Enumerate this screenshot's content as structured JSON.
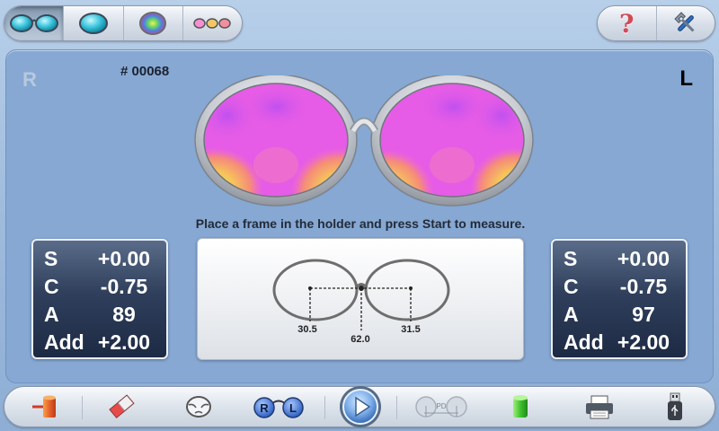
{
  "top_toolbar": {
    "modes": [
      {
        "name": "single-vision-mode",
        "icon": "two-lenses-icon",
        "active": true
      },
      {
        "name": "single-lens-mode",
        "icon": "single-lens-icon",
        "active": false
      },
      {
        "name": "color-map-mode",
        "icon": "color-map-icon",
        "active": false
      },
      {
        "name": "multi-lens-mode",
        "icon": "three-lenses-icon",
        "active": false
      }
    ],
    "help_glyph": "?",
    "settings_icon": "tools-icon"
  },
  "measurement": {
    "side_right": "R",
    "side_left": "L",
    "job_number": "# 00068",
    "instruction": "Place a frame in the holder and press Start to measure."
  },
  "right_lens": {
    "rows": [
      {
        "label": "S",
        "value": "+0.00"
      },
      {
        "label": "C",
        "value": "-0.75"
      },
      {
        "label": "A",
        "value": "89"
      },
      {
        "label": "Add",
        "value": "+2.00"
      }
    ]
  },
  "left_lens": {
    "rows": [
      {
        "label": "S",
        "value": "+0.00"
      },
      {
        "label": "C",
        "value": "-0.75"
      },
      {
        "label": "A",
        "value": "97"
      },
      {
        "label": "Add",
        "value": "+2.00"
      }
    ]
  },
  "frame": {
    "right_pd": "30.5",
    "total_pd": "62.0",
    "left_pd": "31.5"
  },
  "bottom_toolbar": {
    "rl_right": "R",
    "rl_left": "L",
    "pd_label": "PD",
    "items": [
      "exit-icon",
      "eraser-icon",
      "frame-shape-icon",
      "rl-switch-icon",
      "start-play-icon",
      "pd-measure-icon",
      "lens-green-icon",
      "printer-icon",
      "usb-icon"
    ]
  },
  "colors": {
    "panel": "#86a8d3",
    "lens_box": "#2f3f5c",
    "map_magenta": "#e65ce6",
    "map_yellow": "#d8ef50"
  }
}
